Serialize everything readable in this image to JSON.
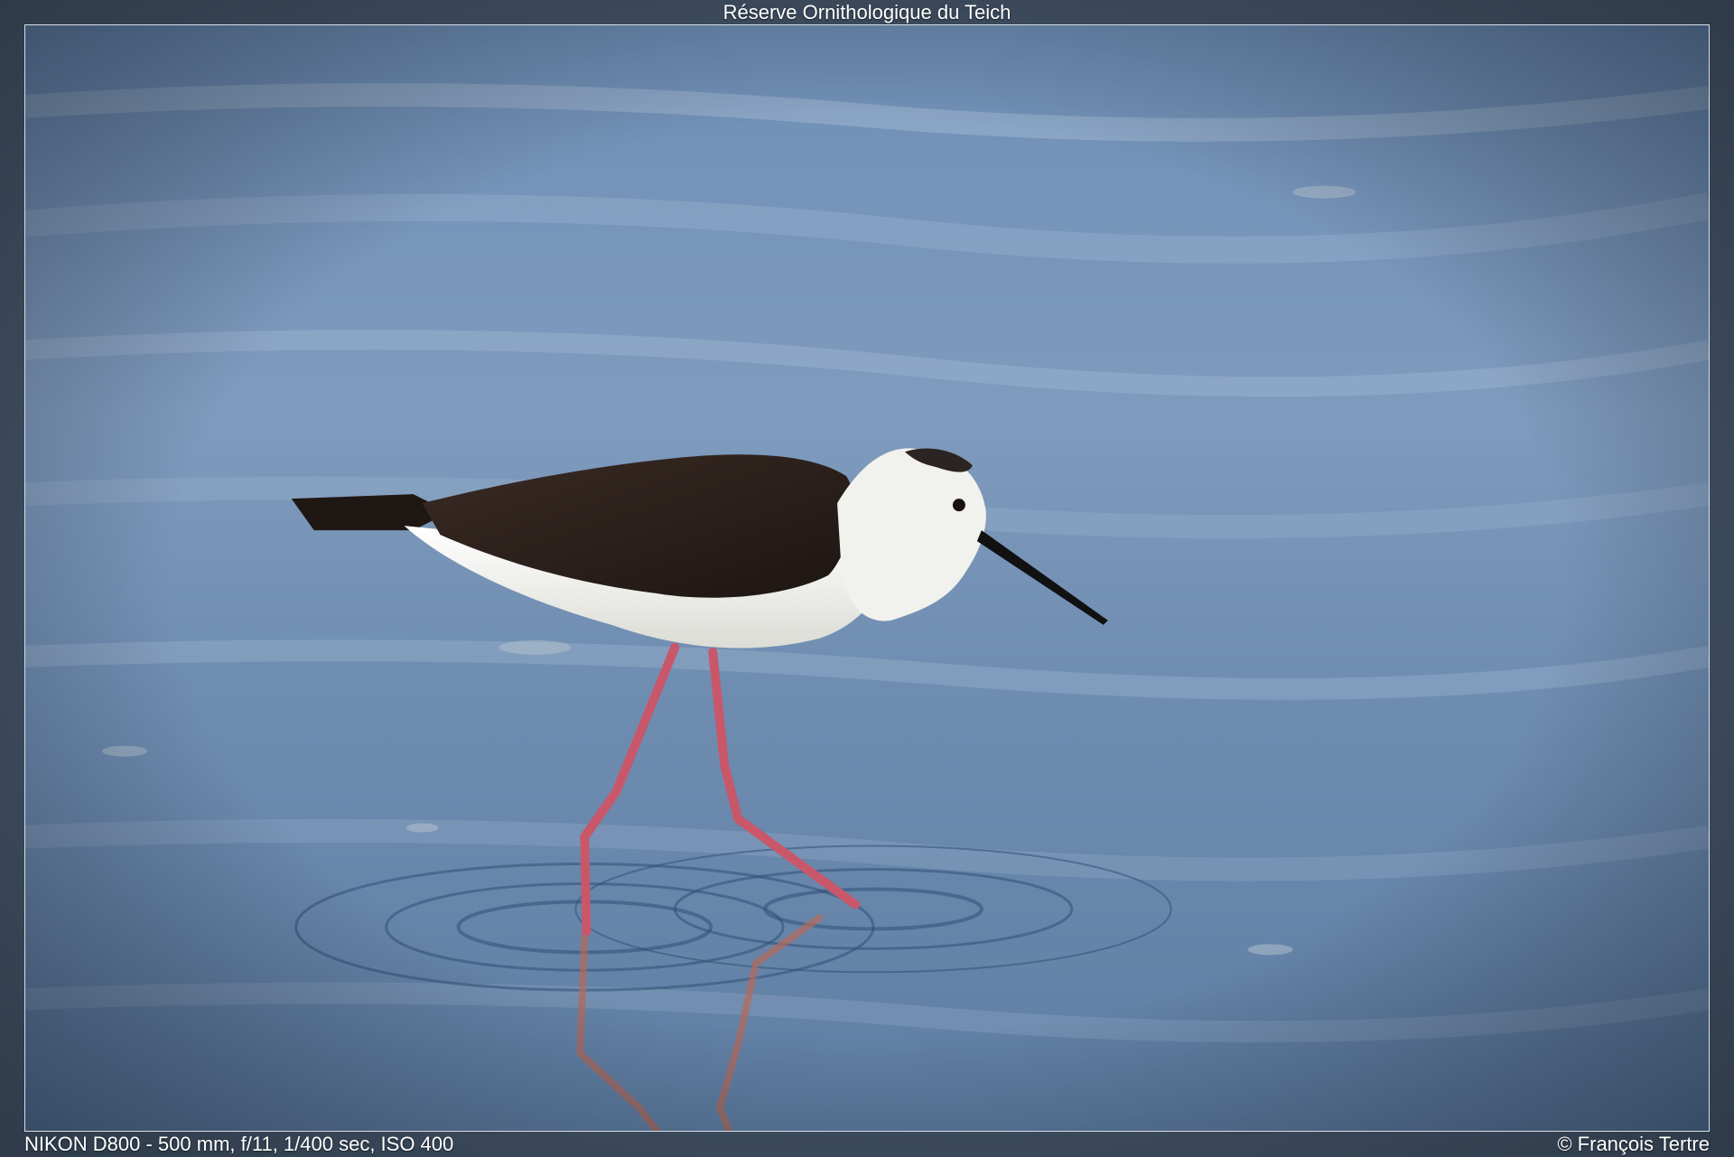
{
  "photo": {
    "title": "Réserve Ornithologique du Teich",
    "exif": "NIKON D800 - 500 mm, f/11, 1/400 sec, ISO 400",
    "credit": "© François Tertre",
    "subject": "wading-bird",
    "colors": {
      "frame": "#3e4d60",
      "water_light": "#8fa8c4",
      "water_dark": "#3f6489",
      "plumage_dark": "#2a1f1c",
      "plumage_white": "#f2f2ee",
      "legs": "#c9576a",
      "beak": "#111111"
    }
  }
}
